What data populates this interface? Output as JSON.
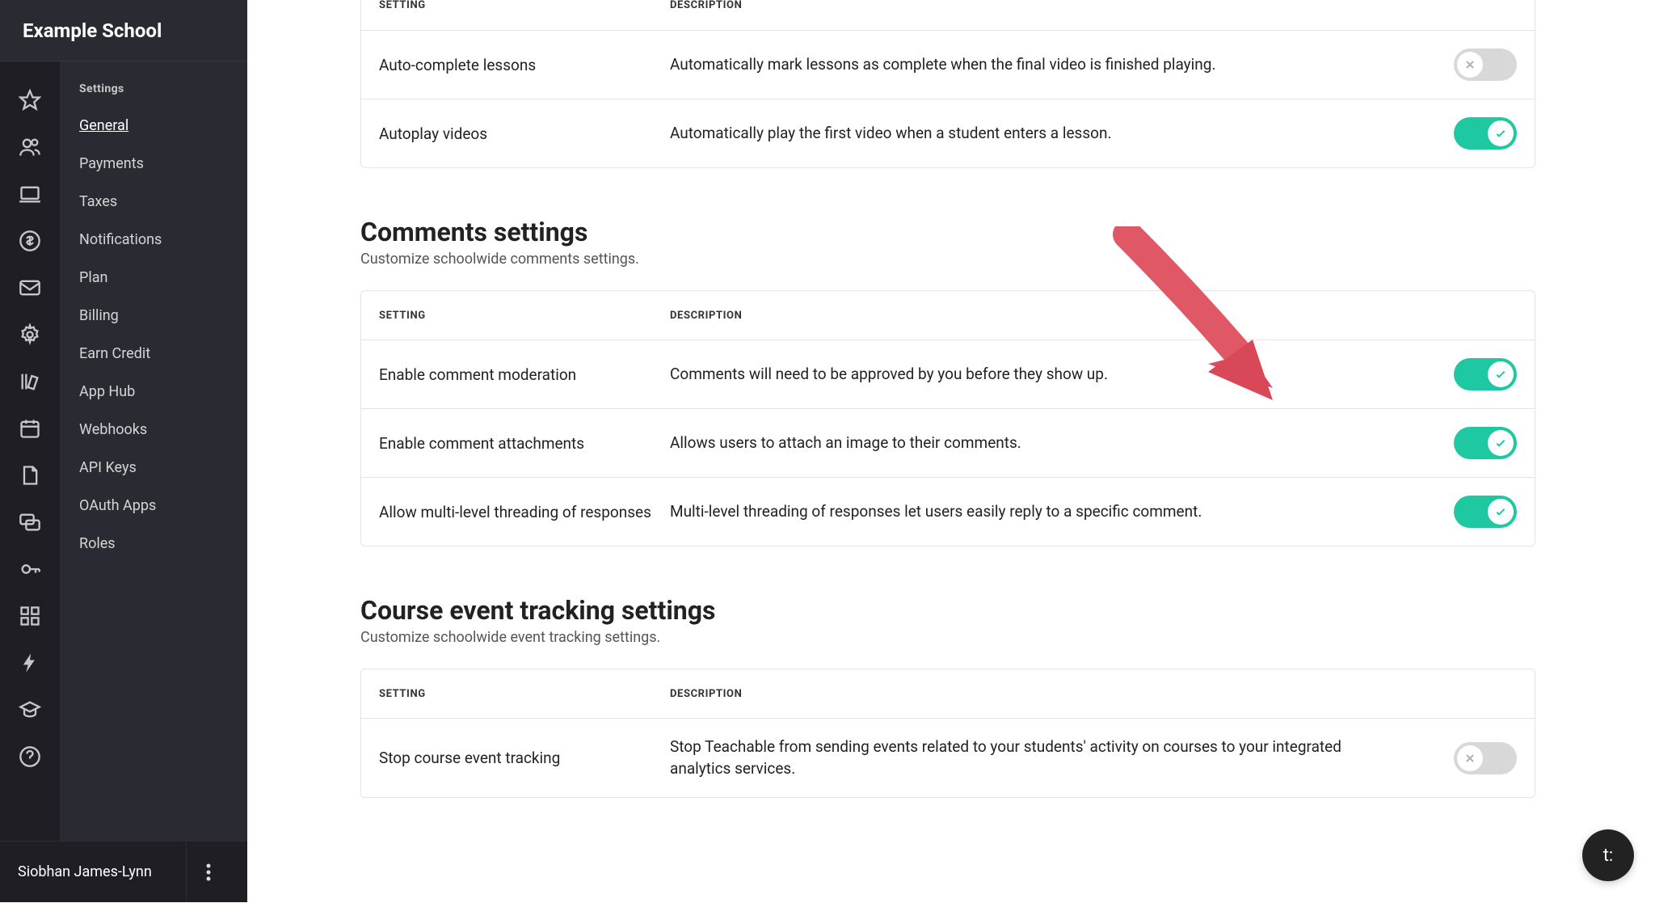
{
  "school_name": "Example School",
  "user_name": "Siobhan James-Lynn",
  "help_bubble_label": "t:",
  "sidebar": {
    "heading": "Settings",
    "items": [
      {
        "label": "General",
        "active": true
      },
      {
        "label": "Payments",
        "active": false
      },
      {
        "label": "Taxes",
        "active": false
      },
      {
        "label": "Notifications",
        "active": false
      },
      {
        "label": "Plan",
        "active": false
      },
      {
        "label": "Billing",
        "active": false
      },
      {
        "label": "Earn Credit",
        "active": false
      },
      {
        "label": "App Hub",
        "active": false
      },
      {
        "label": "Webhooks",
        "active": false
      },
      {
        "label": "API Keys",
        "active": false
      },
      {
        "label": "OAuth Apps",
        "active": false
      },
      {
        "label": "Roles",
        "active": false
      }
    ]
  },
  "icon_rail": [
    "star-icon",
    "users-icon",
    "laptop-icon",
    "dollar-icon",
    "mail-icon",
    "gear-icon",
    "books-icon",
    "calendar-icon",
    "page-icon",
    "chat-icon",
    "key-icon",
    "apps-icon",
    "bolt-icon",
    "graduation-icon",
    "help-icon"
  ],
  "columns": {
    "setting": "SETTING",
    "description": "DESCRIPTION"
  },
  "lesson_section": {
    "rows": [
      {
        "setting": "Auto-complete lessons",
        "description": "Automatically mark lessons as complete when the final video is finished playing.",
        "on": false
      },
      {
        "setting": "Autoplay videos",
        "description": "Automatically play the first video when a student enters a lesson.",
        "on": true
      }
    ]
  },
  "comments_section": {
    "title": "Comments settings",
    "subtitle": "Customize schoolwide comments settings.",
    "rows": [
      {
        "setting": "Enable comment moderation",
        "description": "Comments will need to be approved by you before they show up.",
        "on": true
      },
      {
        "setting": "Enable comment attachments",
        "description": "Allows users to attach an image to their comments.",
        "on": true
      },
      {
        "setting": "Allow multi-level threading of responses",
        "description": "Multi-level threading of responses let users easily reply to a specific comment.",
        "on": true
      }
    ]
  },
  "tracking_section": {
    "title": "Course event tracking settings",
    "subtitle": "Customize schoolwide event tracking settings.",
    "rows": [
      {
        "setting": "Stop course event tracking",
        "description": "Stop Teachable from sending events related to your students' activity on courses to your integrated analytics services.",
        "on": false
      }
    ]
  },
  "colors": {
    "accent": "#1ec8a0",
    "arrow": "#e05766"
  }
}
